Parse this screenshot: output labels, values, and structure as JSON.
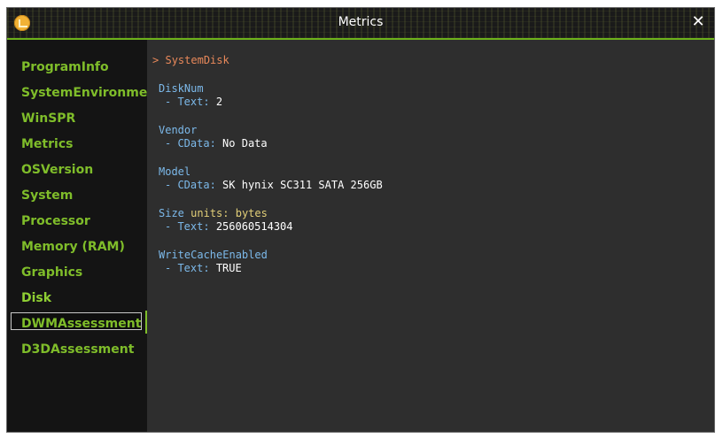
{
  "window": {
    "title": "Metrics"
  },
  "sidebar": {
    "items": [
      {
        "label": "ProgramInfo"
      },
      {
        "label": "SystemEnvironment"
      },
      {
        "label": "WinSPR"
      },
      {
        "label": "Metrics"
      },
      {
        "label": "OSVersion"
      },
      {
        "label": "System"
      },
      {
        "label": "Processor"
      },
      {
        "label": "Memory (RAM)"
      },
      {
        "label": "Graphics"
      },
      {
        "label": "Disk"
      },
      {
        "label": "DWMAssessment"
      },
      {
        "label": "D3DAssessment"
      }
    ],
    "selected": "Disk"
  },
  "content": {
    "section_marker": ">",
    "section_title": "SystemDisk",
    "fields": [
      {
        "name": "DiskNum",
        "key_prefix": "- ",
        "key": "Text:",
        "value": "2"
      },
      {
        "name": "Vendor",
        "key_prefix": "- ",
        "key": "CData:",
        "value": "No Data"
      },
      {
        "name": "Model",
        "key_prefix": "- ",
        "key": "CData:",
        "value": "SK hynix SC311 SATA 256GB"
      },
      {
        "name": "Size",
        "units_label": "units:",
        "units_value": "bytes",
        "key_prefix": "- ",
        "key": "Text:",
        "value": "256060514304"
      },
      {
        "name": "WriteCacheEnabled",
        "key_prefix": "- ",
        "key": "Text:",
        "value": "TRUE"
      }
    ]
  },
  "colors": {
    "accent": "#7fbd2a",
    "section": "#e8885a",
    "field_name": "#7cb9ea",
    "units": "#e2cf78",
    "value": "#ffffff"
  },
  "icons": {
    "app": "app-logo-icon",
    "close": "close-icon"
  }
}
